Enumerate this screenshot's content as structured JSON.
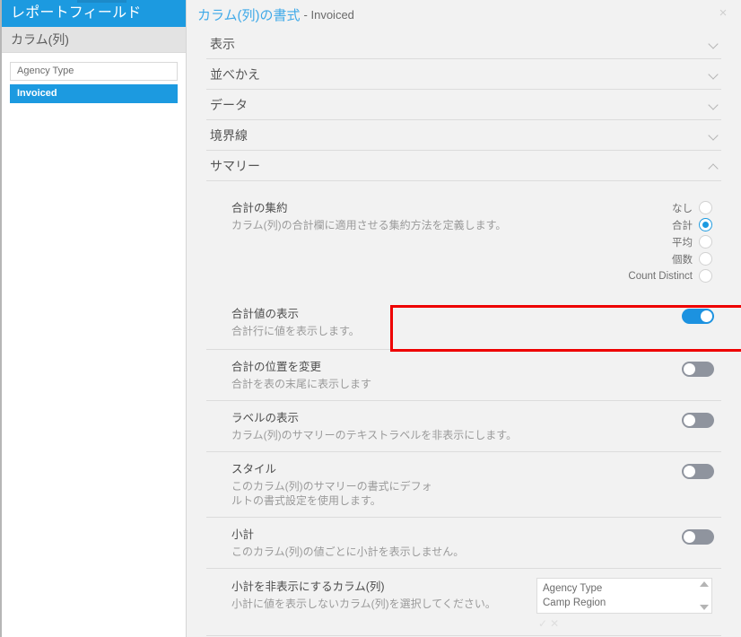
{
  "sidebar": {
    "title": "レポートフィールド",
    "subtitle": "カラム(列)",
    "fields": [
      {
        "label": "Agency Type",
        "selected": false
      },
      {
        "label": "Invoiced",
        "selected": true
      }
    ]
  },
  "panel": {
    "title": "カラム(列)の書式",
    "title_suffix": "- Invoiced",
    "close_icon": "×",
    "sections": [
      {
        "label": "表示",
        "expanded": false
      },
      {
        "label": "並べかえ",
        "expanded": false
      },
      {
        "label": "データ",
        "expanded": false
      },
      {
        "label": "境界線",
        "expanded": false
      },
      {
        "label": "サマリー",
        "expanded": true
      }
    ]
  },
  "summary": {
    "aggregation": {
      "title": "合計の集約",
      "desc": "カラム(列)の合計欄に適用させる集約方法を定義します。",
      "options": [
        {
          "label": "なし",
          "selected": false
        },
        {
          "label": "合計",
          "selected": true
        },
        {
          "label": "平均",
          "selected": false
        },
        {
          "label": "個数",
          "selected": false
        },
        {
          "label": "Count Distinct",
          "selected": false
        }
      ]
    },
    "toggles": [
      {
        "title": "合計値の表示",
        "desc": "合計行に値を表示します。",
        "on": true,
        "highlighted": true
      },
      {
        "title": "合計の位置を変更",
        "desc": "合計を表の末尾に表示します",
        "on": false,
        "highlighted": false
      },
      {
        "title": "ラベルの表示",
        "desc": "カラム(列)のサマリーのテキストラベルを非表示にします。",
        "on": false,
        "highlighted": false
      },
      {
        "title": "スタイル",
        "desc": "このカラム(列)のサマリーの書式にデフォ\nルトの書式設定を使用します。",
        "on": false,
        "highlighted": false
      },
      {
        "title": "小計",
        "desc": "このカラム(列)の値ごとに小計を表示しません。",
        "on": false,
        "highlighted": false
      }
    ],
    "exclude_columns": {
      "title": "小計を非表示にするカラム(列)",
      "desc": "小計に値を表示しないカラム(列)を選択してください。",
      "options": [
        "Agency Type",
        "Camp Region"
      ],
      "tools": {
        "check_icon": "✓",
        "clear_icon": "✕"
      }
    }
  },
  "colors": {
    "accent_blue": "#1c9ae0",
    "toggle_on": "#1c92e0",
    "toggle_off": "#8f949e",
    "highlight_red": "#ee0000",
    "panel_bg": "#f2f2f2"
  }
}
